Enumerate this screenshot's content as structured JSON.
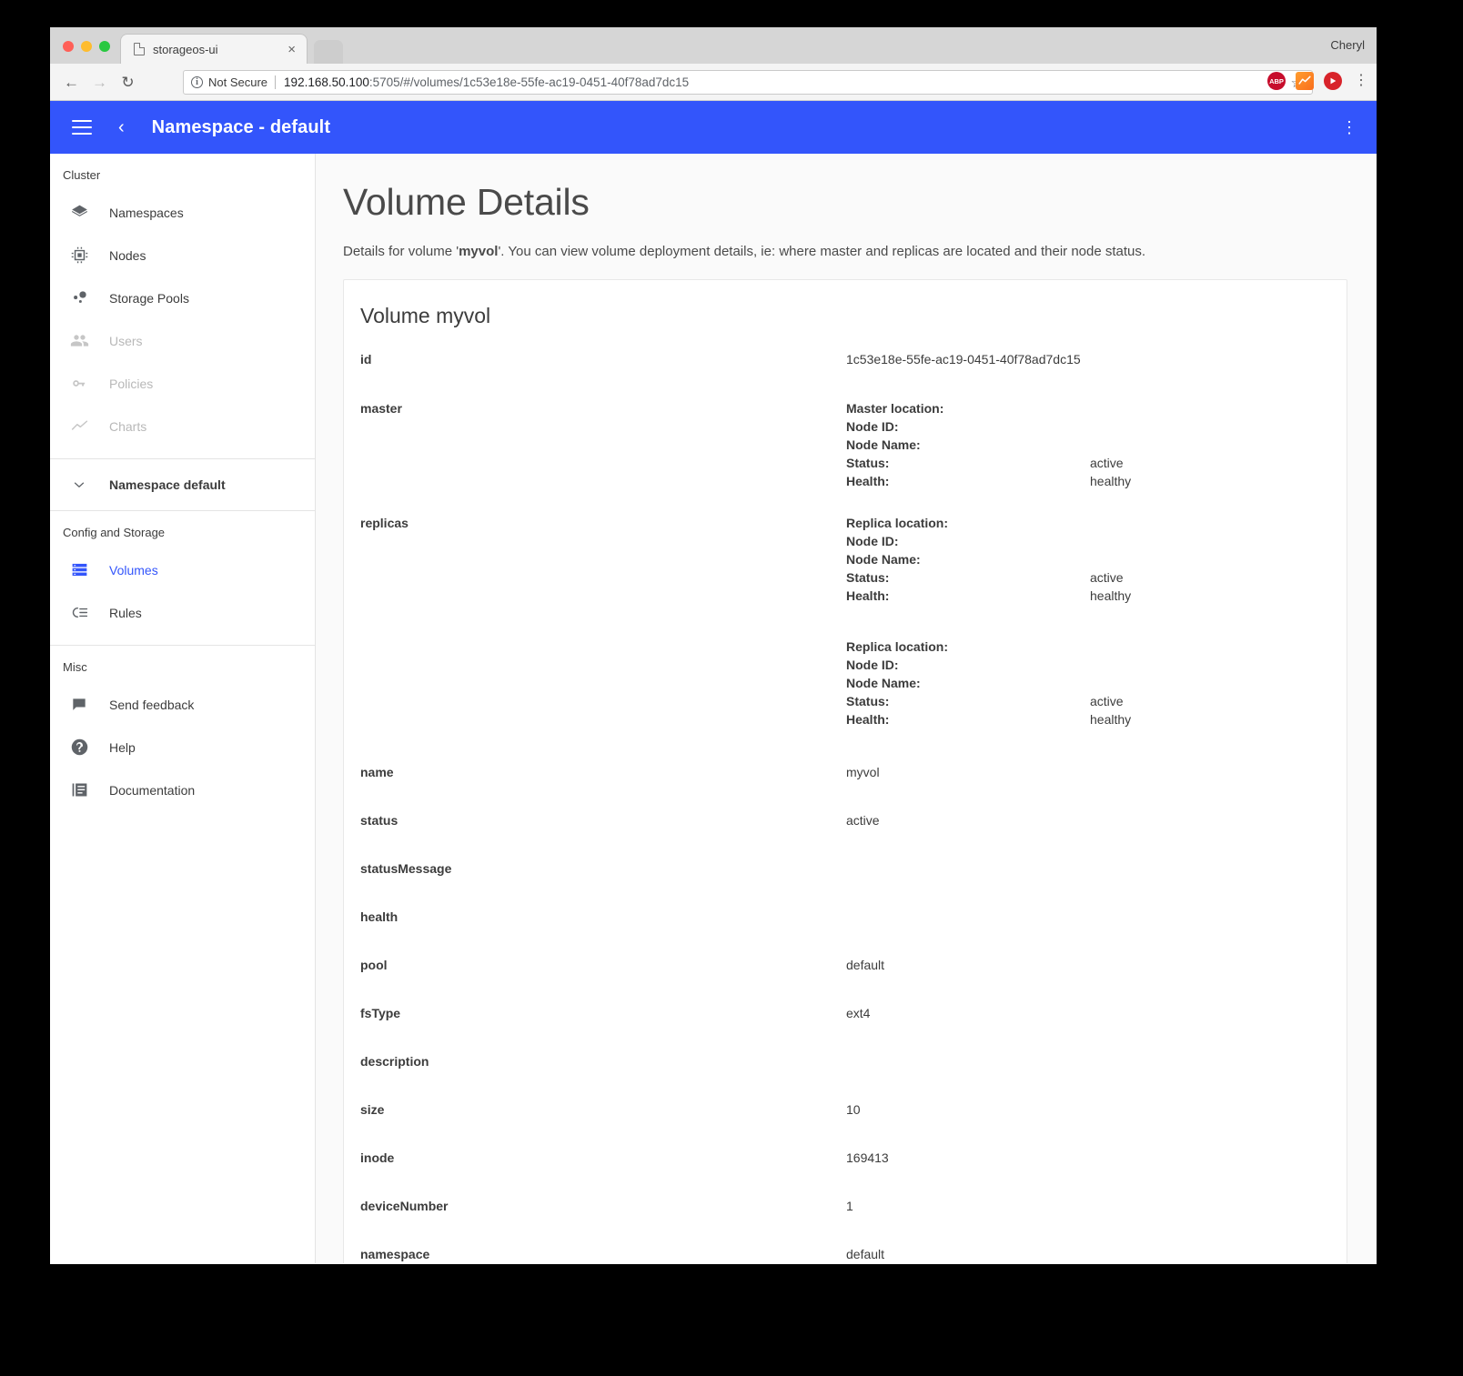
{
  "browser": {
    "tab": {
      "title": "storageos-ui",
      "close_label": "×",
      "doc_icon": "document-icon"
    },
    "profile": "Cheryl",
    "nav": {
      "back": "←",
      "forward": "→",
      "reload": "↻"
    },
    "omnibox": {
      "info_glyph": "i",
      "security_label": "Not Secure",
      "url_host": "192.168.50.100",
      "url_rest": ":5705/#/volumes/1c53e18e-55fe-ac19-0451-40f78ad7dc15",
      "key_icon": "⚷",
      "star_icon": "☆"
    },
    "extensions": [
      {
        "name": "adblock-plus-extension-icon",
        "label": "ABP"
      },
      {
        "name": "chart-extension-icon",
        "label": ""
      },
      {
        "name": "play-extension-icon",
        "label": "▶"
      }
    ],
    "menu_glyph": "⋮"
  },
  "appbar": {
    "menu_icon": "hamburger-menu-icon",
    "back_icon": "‹",
    "title": "Namespace - default",
    "kebab_icon": "⋮",
    "color": "#3355fb"
  },
  "sidebar": {
    "sections": [
      {
        "heading": "Cluster",
        "items": [
          {
            "label": "Namespaces",
            "icon": "layers-icon",
            "state": "normal"
          },
          {
            "label": "Nodes",
            "icon": "chip-icon",
            "state": "normal"
          },
          {
            "label": "Storage Pools",
            "icon": "storage-pools-icon",
            "state": "normal"
          },
          {
            "label": "Users",
            "icon": "users-icon",
            "state": "disabled"
          },
          {
            "label": "Policies",
            "icon": "key-icon",
            "state": "disabled"
          },
          {
            "label": "Charts",
            "icon": "line-chart-icon",
            "state": "disabled"
          }
        ]
      },
      {
        "heading": "",
        "items": [
          {
            "label": "Namespace default",
            "icon": "chevron-down-icon",
            "state": "bold"
          }
        ]
      },
      {
        "heading": "Config and Storage",
        "items": [
          {
            "label": "Volumes",
            "icon": "volumes-icon",
            "state": "active"
          },
          {
            "label": "Rules",
            "icon": "rules-icon",
            "state": "normal"
          }
        ]
      },
      {
        "heading": "Misc",
        "items": [
          {
            "label": "Send feedback",
            "icon": "feedback-icon",
            "state": "normal"
          },
          {
            "label": "Help",
            "icon": "help-icon",
            "state": "normal"
          },
          {
            "label": "Documentation",
            "icon": "documentation-icon",
            "state": "normal"
          }
        ]
      }
    ]
  },
  "main": {
    "title": "Volume Details",
    "description_pre": "Details for volume '",
    "description_bold": "myvol",
    "description_post": "'. You can view volume deployment details, ie: where master and replicas are located and their node status.",
    "card_title": "Volume myvol",
    "rows": [
      {
        "key": "id",
        "value": "1c53e18e-55fe-ac19-0451-40f78ad7dc15"
      },
      {
        "key": "name",
        "value": "myvol"
      },
      {
        "key": "status",
        "value": "active"
      },
      {
        "key": "statusMessage",
        "value": ""
      },
      {
        "key": "health",
        "value": ""
      },
      {
        "key": "pool",
        "value": "default"
      },
      {
        "key": "fsType",
        "value": "ext4"
      },
      {
        "key": "description",
        "value": ""
      },
      {
        "key": "size",
        "value": "10"
      },
      {
        "key": "inode",
        "value": "169413"
      },
      {
        "key": "deviceNumber",
        "value": "1"
      },
      {
        "key": "namespace",
        "value": "default"
      }
    ],
    "master": {
      "key": "master",
      "blocks": [
        {
          "lines": [
            {
              "k": "Master location:",
              "v": ""
            },
            {
              "k": "Node ID:",
              "v": ""
            },
            {
              "k": "Node Name:",
              "v": ""
            },
            {
              "k": "Status:",
              "v": "active"
            },
            {
              "k": "Health:",
              "v": "healthy"
            }
          ]
        }
      ]
    },
    "replicas": {
      "key": "replicas",
      "blocks": [
        {
          "lines": [
            {
              "k": "Replica location:",
              "v": ""
            },
            {
              "k": "Node ID:",
              "v": ""
            },
            {
              "k": "Node Name:",
              "v": ""
            },
            {
              "k": "Status:",
              "v": "active"
            },
            {
              "k": "Health:",
              "v": "healthy"
            }
          ]
        },
        {
          "lines": [
            {
              "k": "Replica location:",
              "v": ""
            },
            {
              "k": "Node ID:",
              "v": ""
            },
            {
              "k": "Node Name:",
              "v": ""
            },
            {
              "k": "Status:",
              "v": "active"
            },
            {
              "k": "Health:",
              "v": "healthy"
            }
          ]
        }
      ]
    }
  }
}
